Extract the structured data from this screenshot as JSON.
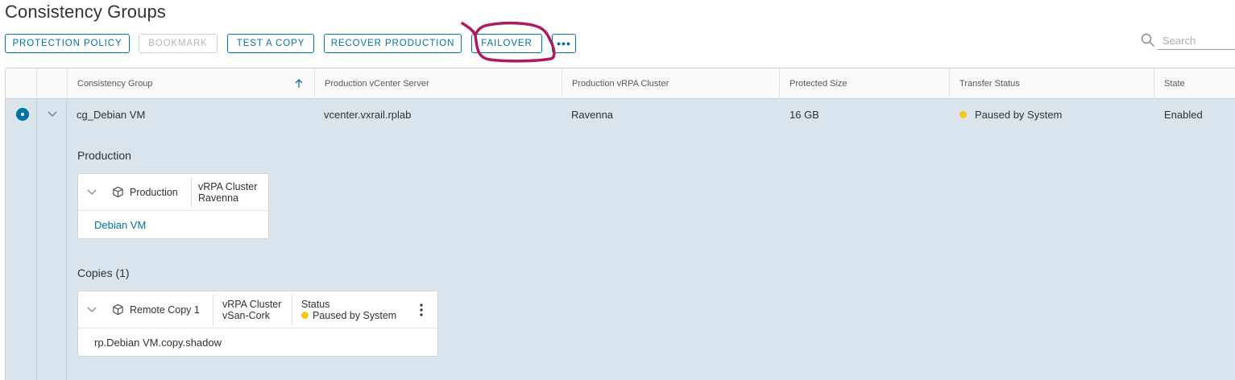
{
  "page": {
    "title": "Consistency Groups"
  },
  "toolbar": {
    "protection_policy": "PROTECTION POLICY",
    "bookmark": "BOOKMARK",
    "test_a_copy": "TEST A COPY",
    "recover_production": "RECOVER PRODUCTION",
    "failover": "FAILOVER",
    "more": "•••"
  },
  "search": {
    "placeholder": "Search",
    "value": ""
  },
  "grid": {
    "columns": [
      "Consistency Group",
      "Production vCenter Server",
      "Production vRPA Cluster",
      "Protected Size",
      "Transfer Status",
      "State"
    ],
    "sort": {
      "column": "Consistency Group",
      "direction": "ascending"
    },
    "rows": [
      {
        "consistency_group": "cg_Debian VM",
        "vcenter": "vcenter.vxrail.rplab",
        "vrpa_cluster": "Ravenna",
        "protected_size": "16 GB",
        "transfer_status": "Paused by System",
        "state": "Enabled",
        "selected": true,
        "expanded": true
      }
    ]
  },
  "details": {
    "production": {
      "title": "Production",
      "card": {
        "name": "Production",
        "cluster_label": "vRPA Cluster",
        "cluster_value": "Ravenna",
        "vm_link": "Debian VM"
      }
    },
    "copies": {
      "title": "Copies (1)",
      "card": {
        "name": "Remote Copy 1",
        "cluster_label": "vRPA Cluster",
        "cluster_value": "vSan-Cork",
        "status_label": "Status",
        "status_value": "Paused by System",
        "shadow": "rp.Debian VM.copy.shadow"
      }
    }
  },
  "colors": {
    "accent": "#0072a3",
    "selected_row": "#d9e4ec",
    "status_paused": "#f5c518",
    "annotation": "#b0195f"
  },
  "icons": [
    "search-icon",
    "sort-ascending-icon",
    "chevron-down-icon",
    "box-icon",
    "kebab-menu-icon"
  ]
}
